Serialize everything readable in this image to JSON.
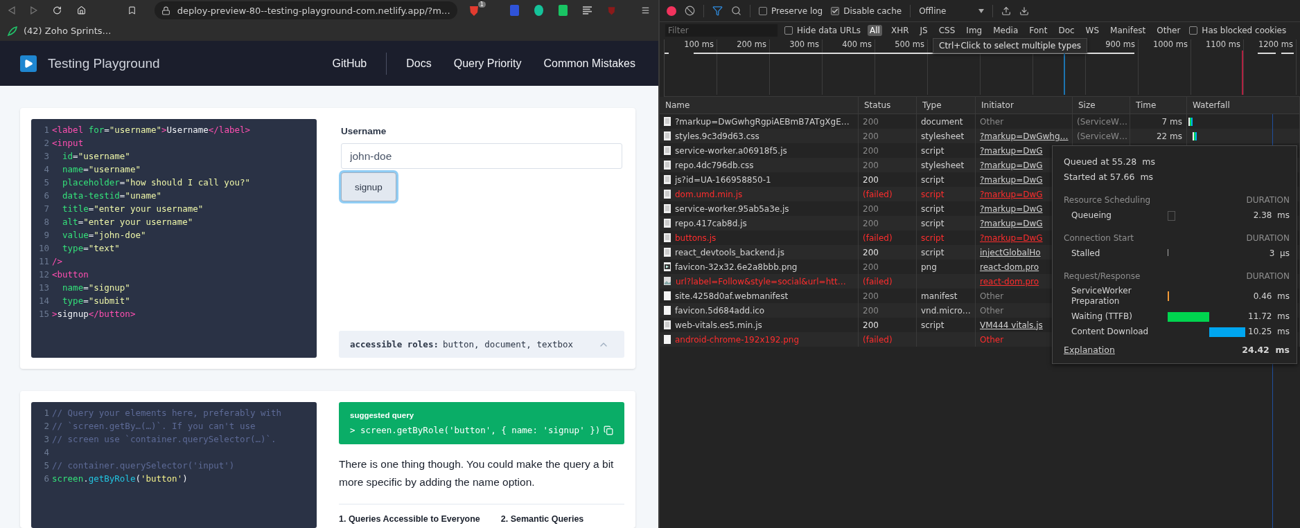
{
  "browser": {
    "url": "deploy-preview-80--testing-playground-com.netlify.app/?m…",
    "shield_badge": "1",
    "bookmarks": [
      {
        "label": "(42) Zoho Sprints…"
      }
    ]
  },
  "site": {
    "title": "Testing Playground",
    "nav": [
      {
        "label": "GitHub"
      },
      {
        "label": "Docs"
      },
      {
        "label": "Query Priority"
      },
      {
        "label": "Common Mistakes"
      }
    ]
  },
  "markup_editor": {
    "lines": [
      {
        "number": "1",
        "tokens": [
          {
            "kind": "tag",
            "text": "<label"
          },
          {
            "kind": "attr",
            "text": " for"
          },
          {
            "kind": "plain",
            "text": "="
          },
          {
            "kind": "string",
            "text": "\"username\""
          },
          {
            "kind": "tag",
            "text": ">"
          },
          {
            "kind": "plain",
            "text": "Username"
          },
          {
            "kind": "tag",
            "text": "</label>"
          }
        ]
      },
      {
        "number": "2",
        "tokens": [
          {
            "kind": "tag",
            "text": "<input"
          }
        ]
      },
      {
        "number": "3",
        "tokens": [
          {
            "kind": "attr",
            "text": "  id"
          },
          {
            "kind": "plain",
            "text": "="
          },
          {
            "kind": "string",
            "text": "\"username\""
          }
        ]
      },
      {
        "number": "4",
        "tokens": [
          {
            "kind": "attr",
            "text": "  name"
          },
          {
            "kind": "plain",
            "text": "="
          },
          {
            "kind": "string",
            "text": "\"username\""
          }
        ]
      },
      {
        "number": "5",
        "tokens": [
          {
            "kind": "attr",
            "text": "  placeholder"
          },
          {
            "kind": "plain",
            "text": "="
          },
          {
            "kind": "string",
            "text": "\"how should I call you?\""
          }
        ]
      },
      {
        "number": "6",
        "tokens": [
          {
            "kind": "attr",
            "text": "  data-testid"
          },
          {
            "kind": "plain",
            "text": "="
          },
          {
            "kind": "string",
            "text": "\"uname\""
          }
        ]
      },
      {
        "number": "7",
        "tokens": [
          {
            "kind": "attr",
            "text": "  title"
          },
          {
            "kind": "plain",
            "text": "="
          },
          {
            "kind": "string",
            "text": "\"enter your username\""
          }
        ]
      },
      {
        "number": "8",
        "tokens": [
          {
            "kind": "attr",
            "text": "  alt"
          },
          {
            "kind": "plain",
            "text": "="
          },
          {
            "kind": "string",
            "text": "\"enter your username\""
          }
        ]
      },
      {
        "number": "9",
        "tokens": [
          {
            "kind": "attr",
            "text": "  value"
          },
          {
            "kind": "plain",
            "text": "="
          },
          {
            "kind": "string",
            "text": "\"john-doe\""
          }
        ]
      },
      {
        "number": "10",
        "tokens": [
          {
            "kind": "attr",
            "text": "  type"
          },
          {
            "kind": "plain",
            "text": "="
          },
          {
            "kind": "string",
            "text": "\"text\""
          }
        ]
      },
      {
        "number": "11",
        "tokens": [
          {
            "kind": "tag",
            "text": "/>"
          }
        ]
      },
      {
        "number": "12",
        "tokens": [
          {
            "kind": "tag",
            "text": "<button"
          }
        ]
      },
      {
        "number": "13",
        "tokens": [
          {
            "kind": "attr",
            "text": "  name"
          },
          {
            "kind": "plain",
            "text": "="
          },
          {
            "kind": "string",
            "text": "\"signup\""
          }
        ]
      },
      {
        "number": "14",
        "tokens": [
          {
            "kind": "attr",
            "text": "  type"
          },
          {
            "kind": "plain",
            "text": "="
          },
          {
            "kind": "string",
            "text": "\"submit\""
          }
        ]
      },
      {
        "number": "15",
        "tokens": [
          {
            "kind": "tag",
            "text": ">"
          },
          {
            "kind": "plain",
            "text": "signup"
          },
          {
            "kind": "tag",
            "text": "</button>"
          }
        ]
      }
    ]
  },
  "preview": {
    "field_label": "Username",
    "field_value": "john-doe",
    "button": "signup",
    "button_focused": true,
    "roles_label": "accessible roles:",
    "roles": "button, document, textbox"
  },
  "query_editor": {
    "lines": [
      {
        "number": "1",
        "tokens": [
          {
            "kind": "comment",
            "text": "// Query your elements here, preferably with"
          }
        ]
      },
      {
        "number": "2",
        "tokens": [
          {
            "kind": "comment",
            "text": "// `screen.getBy…(…)`. If you can't use"
          }
        ]
      },
      {
        "number": "3",
        "tokens": [
          {
            "kind": "comment",
            "text": "// screen use `container.querySelector(…)`."
          }
        ]
      },
      {
        "number": "4"
      },
      {
        "number": "5",
        "tokens": [
          {
            "kind": "comment",
            "text": "// container.querySelector('input')"
          }
        ]
      },
      {
        "number": "6",
        "tokens": [
          {
            "kind": "ident",
            "text": "screen"
          },
          {
            "kind": "plain",
            "text": "."
          },
          {
            "kind": "method",
            "text": "getByRole"
          },
          {
            "kind": "plain",
            "text": "("
          },
          {
            "kind": "quote",
            "text": "'button'"
          },
          {
            "kind": "plain",
            "text": ")"
          }
        ]
      }
    ]
  },
  "suggestion": {
    "title": "suggested query",
    "query": "> screen.getByRole('button', { name: 'signup' })",
    "note": "There is one thing though. You could make the query a bit more specific by adding the name option.",
    "columns": [
      {
        "heading": "1. Queries Accessible to Everyone"
      },
      {
        "heading": "2. Semantic Queries"
      }
    ]
  },
  "devtools": {
    "toolbar": {
      "recording": true,
      "preserve_log": {
        "label": "Preserve log",
        "checked": false
      },
      "disable_cache": {
        "label": "Disable cache",
        "checked": true
      },
      "throttling": "Offline"
    },
    "filter": {
      "placeholder": "Filter",
      "hide_data_urls": {
        "label": "Hide data URLs",
        "checked": false
      },
      "types": [
        {
          "label": "All",
          "selected": true
        },
        {
          "label": "XHR",
          "selected": false
        },
        {
          "label": "JS",
          "selected": false
        },
        {
          "label": "CSS",
          "selected": false
        },
        {
          "label": "Img",
          "selected": false
        },
        {
          "label": "Media",
          "selected": false
        },
        {
          "label": "Font",
          "selected": false
        },
        {
          "label": "Doc",
          "selected": false
        },
        {
          "label": "WS",
          "selected": false
        },
        {
          "label": "Manifest",
          "selected": false
        },
        {
          "label": "Other",
          "selected": false
        }
      ],
      "blocked_cookies": {
        "label": "Has blocked cookies",
        "checked": false
      }
    },
    "tooltip": "Ctrl+Click to select multiple types",
    "overview": {
      "ticks": [
        {
          "label": "100 ms"
        },
        {
          "label": "200 ms"
        },
        {
          "label": "300 ms"
        },
        {
          "label": "400 ms"
        },
        {
          "label": "500 ms"
        },
        {
          "label": "900 ms"
        },
        {
          "label": "1000 ms"
        },
        {
          "label": "1100 ms"
        },
        {
          "label": "1200 ms"
        }
      ]
    },
    "columns": [
      "Name",
      "Status",
      "Type",
      "Initiator",
      "Size",
      "Time",
      "Waterfall"
    ],
    "requests": [
      {
        "name": "?markup=DwGwhgRgpiAEBmB7ATgXgE…",
        "status": "200",
        "type": "document",
        "initiator": "Other",
        "initiator_link": false,
        "size": "(ServiceW…",
        "time": "7 ms",
        "failed": false,
        "dimmed": true,
        "kind": "document"
      },
      {
        "name": "styles.9c3d9d63.css",
        "status": "200",
        "type": "stylesheet",
        "initiator": "?markup=DwGwhg…",
        "initiator_link": true,
        "size": "(ServiceW…",
        "time": "22 ms",
        "failed": false,
        "dimmed": true,
        "kind": "document"
      },
      {
        "name": "service-worker.a06918f5.js",
        "status": "200",
        "type": "script",
        "initiator": "?markup=DwG",
        "initiator_link": true,
        "failed": false,
        "dimmed": true,
        "kind": "document"
      },
      {
        "name": "repo.4dc796db.css",
        "status": "200",
        "type": "stylesheet",
        "initiator": "?markup=DwG",
        "initiator_link": true,
        "failed": false,
        "dimmed": true,
        "kind": "document"
      },
      {
        "name": "js?id=UA-166958850-1",
        "status": "200",
        "type": "script",
        "initiator": "?markup=DwG",
        "initiator_link": true,
        "failed": false,
        "dimmed": false,
        "kind": "document"
      },
      {
        "name": "dom.umd.min.js",
        "status": "(failed)",
        "type": "script",
        "initiator": "?markup=DwG",
        "initiator_link": true,
        "failed": true,
        "kind": "document"
      },
      {
        "name": "service-worker.95ab5a3e.js",
        "status": "200",
        "type": "script",
        "initiator": "?markup=DwG",
        "initiator_link": true,
        "failed": false,
        "dimmed": true,
        "kind": "document"
      },
      {
        "name": "repo.417cab8d.js",
        "status": "200",
        "type": "script",
        "initiator": "?markup=DwG",
        "initiator_link": true,
        "failed": false,
        "dimmed": true,
        "kind": "document"
      },
      {
        "name": "buttons.js",
        "status": "(failed)",
        "type": "script",
        "initiator": "?markup=DwG",
        "initiator_link": true,
        "failed": true,
        "kind": "document"
      },
      {
        "name": "react_devtools_backend.js",
        "status": "200",
        "type": "script",
        "initiator": "injectGlobalHo",
        "initiator_link": true,
        "failed": false,
        "dimmed": false,
        "kind": "document"
      },
      {
        "name": "favicon-32x32.6e2a8bbb.png",
        "status": "200",
        "type": "png",
        "initiator": "react-dom.pro",
        "initiator_link": true,
        "failed": false,
        "dimmed": true,
        "kind": "image"
      },
      {
        "name": "url?label=Follow&style=social&url=htt…",
        "status": "(failed)",
        "initiator": "react-dom.pro",
        "initiator_link": true,
        "failed": true,
        "kind": "broken"
      },
      {
        "name": "site.4258d0af.webmanifest",
        "status": "200",
        "type": "manifest",
        "initiator": "Other",
        "initiator_link": false,
        "failed": false,
        "dimmed": true,
        "kind": "blank"
      },
      {
        "name": "favicon.5d684add.ico",
        "status": "200",
        "type": "vnd.micro…",
        "initiator": "Other",
        "initiator_link": false,
        "failed": false,
        "dimmed": true,
        "kind": "blank"
      },
      {
        "name": "web-vitals.es5.min.js",
        "status": "200",
        "type": "script",
        "initiator": "VM444 vitals.js",
        "initiator_link": true,
        "failed": false,
        "dimmed": false,
        "kind": "document"
      },
      {
        "name": "android-chrome-192x192.png",
        "status": "(failed)",
        "initiator": "Other",
        "initiator_link": false,
        "failed": true,
        "kind": "blank"
      }
    ],
    "timing": {
      "queued": "Queued at 55.28  ms",
      "started": "Started at 57.66  ms",
      "sections": [
        {
          "title": "Resource Scheduling",
          "duration_header": "DURATION",
          "phases": [
            {
              "label": "Queueing",
              "duration": "2.38  ms",
              "kind": "queueing"
            }
          ]
        },
        {
          "title": "Connection Start",
          "duration_header": "DURATION",
          "phases": [
            {
              "label": "Stalled",
              "duration": "3  µs",
              "kind": "stalled"
            }
          ]
        },
        {
          "title": "Request/Response",
          "duration_header": "DURATION",
          "phases": [
            {
              "label": "ServiceWorker Preparation",
              "duration": "0.46  ms",
              "kind": "preparation",
              "color": "#f29a38"
            },
            {
              "label": "Waiting (TTFB)",
              "duration": "11.72  ms",
              "kind": "waiting",
              "color": "#00d44f"
            },
            {
              "label": "Content Download",
              "duration": "10.25  ms",
              "kind": "download",
              "color": "#00a6f0"
            }
          ]
        }
      ],
      "explanation": "Explanation",
      "total": "24.42  ms"
    }
  }
}
